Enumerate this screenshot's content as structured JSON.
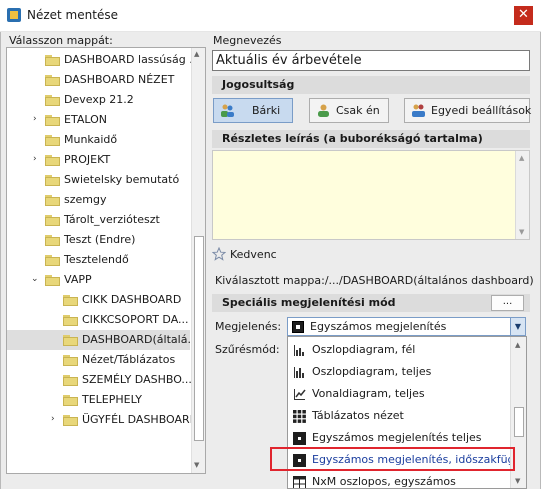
{
  "window": {
    "title": "Nézet mentése",
    "close_glyph": "✕"
  },
  "tree": {
    "label": "Válasszon mappát:",
    "items": [
      {
        "label": "DASHBOARD lassúság ..."
      },
      {
        "label": "DASHBOARD NÉZET"
      },
      {
        "label": "Devexp 21.2"
      },
      {
        "label": "ETALON"
      },
      {
        "label": "Munkaidő"
      },
      {
        "label": "PROJEKT"
      },
      {
        "label": "Swietelsky bemutató"
      },
      {
        "label": "szemgy"
      },
      {
        "label": "Tárolt_verzióteszt"
      },
      {
        "label": "Teszt (Endre)"
      },
      {
        "label": "Tesztelendő"
      },
      {
        "label": "VAPP"
      },
      {
        "label": "CIKK DASHBOARD"
      },
      {
        "label": "CIKKCSOPORT DA..."
      },
      {
        "label": "DASHBOARD(általá..."
      },
      {
        "label": "Nézet/Táblázatos"
      },
      {
        "label": "SZEMÉLY DASHBO..."
      },
      {
        "label": "TELEPHELY"
      },
      {
        "label": "ÜGYFÉL DASHBOARD"
      }
    ]
  },
  "name_field": {
    "label": "Megnevezés",
    "value": "Aktuális év árbevétele"
  },
  "permissions": {
    "header": "Jogosultság",
    "buttons": [
      {
        "label": "Bárki",
        "icon": "users-icon"
      },
      {
        "label": "Csak én",
        "icon": "user-icon"
      },
      {
        "label": "Egyedi beállítások",
        "icon": "custom-users-icon"
      }
    ]
  },
  "description": {
    "header": "Részletes leírás (a buborékságó tartalma)",
    "value": ""
  },
  "favorite": {
    "label": "Kedvenc",
    "icon": "star-icon"
  },
  "selected_folder": {
    "label": "Kiválasztott mappa:/.../DASHBOARD(általános dashboard)"
  },
  "display_mode": {
    "header": "Speciális megjelenítési mód",
    "dots_label": "...",
    "display_label": "Megjelenés:",
    "filter_label": "Szűrésmód:",
    "selected": "Egyszámos megjelenítés",
    "options": [
      {
        "label": "Oszlopdiagram, fél",
        "icon": "half-bar-chart-icon"
      },
      {
        "label": "Oszlopdiagram, teljes",
        "icon": "bar-chart-icon"
      },
      {
        "label": "Vonaldiagram, teljes",
        "icon": "line-chart-icon"
      },
      {
        "label": "Táblázatos nézet",
        "icon": "grid-icon"
      },
      {
        "label": "Egyszámos megjelenítés teljes",
        "icon": "single-number-icon"
      },
      {
        "label": "Egyszámos megjelenítés, időszakfüggő",
        "icon": "single-number-icon"
      },
      {
        "label": "NxM oszlopos, egyszámos",
        "icon": "table-icon"
      }
    ]
  },
  "colors": {
    "highlight_box": "#e0252e",
    "folder": "#e8d77a",
    "active_button": "#c8daef",
    "description_bg": "#fffedd"
  }
}
